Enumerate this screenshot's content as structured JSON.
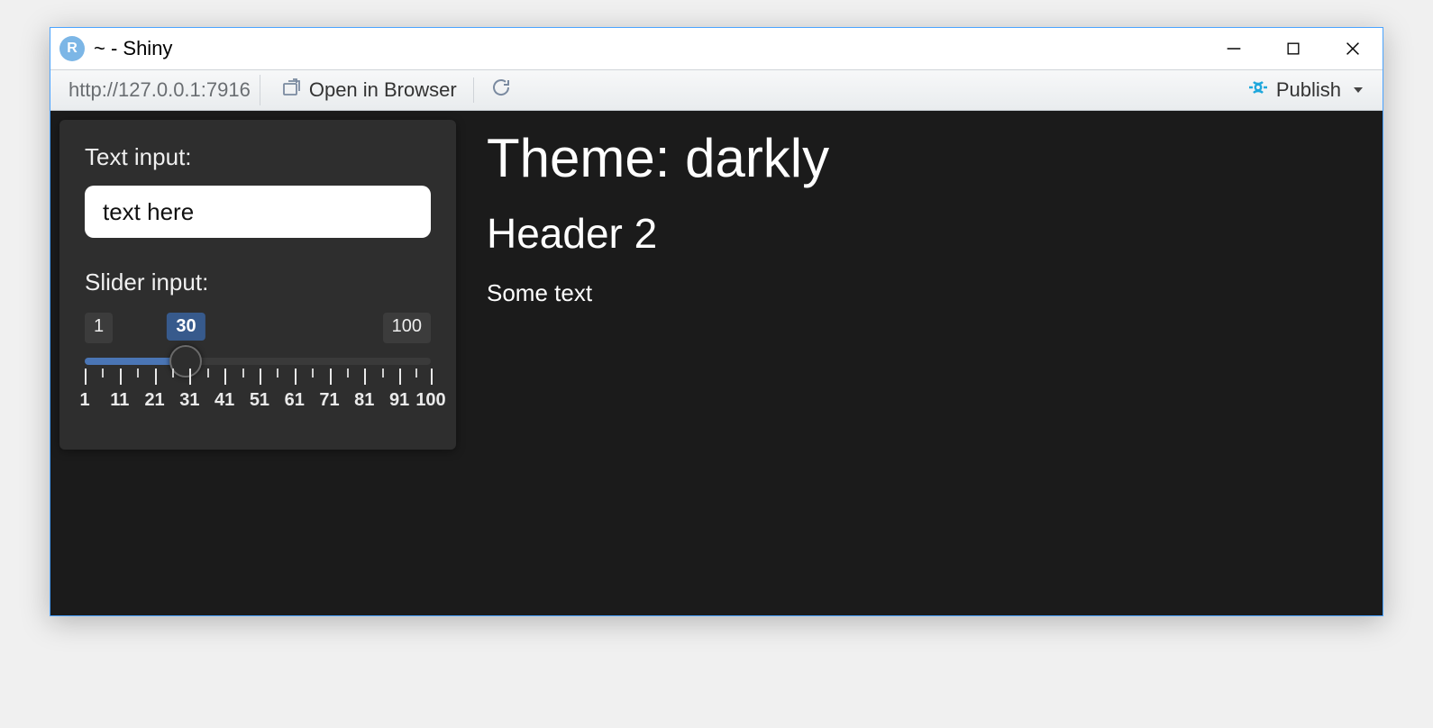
{
  "window": {
    "r_badge": "R",
    "title": "~ - Shiny"
  },
  "toolbar": {
    "url": "http://127.0.0.1:7916",
    "open_in_browser": "Open in Browser",
    "publish": "Publish"
  },
  "sidebar": {
    "text_label": "Text input:",
    "text_value": "text here",
    "slider_label": "Slider input:",
    "slider": {
      "min": 1,
      "max": 100,
      "value": 30,
      "tick_labels": [
        1,
        11,
        21,
        31,
        41,
        51,
        61,
        71,
        81,
        91,
        100
      ]
    }
  },
  "main": {
    "h1": "Theme: darkly",
    "h2": "Header 2",
    "p": "Some text"
  }
}
